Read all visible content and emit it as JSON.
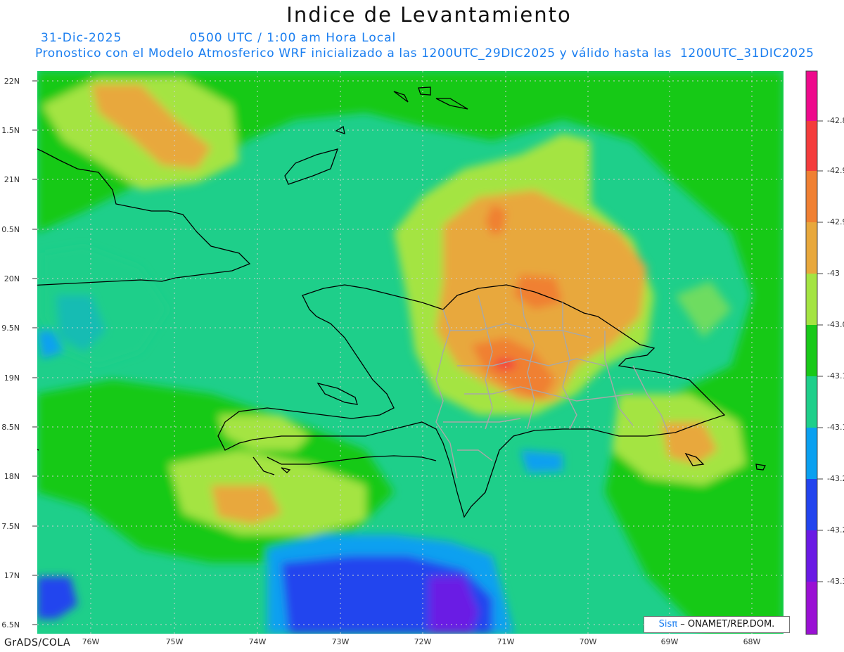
{
  "header": {
    "title": "Indice de Levantamiento",
    "date": "31-Dic-2025",
    "time": "0500 UTC / 1:00 am Hora Local",
    "subtitle": "Pronostico con el Modelo Atmosferico WRF inicializado a las 1200UTC_29DIC2025 y válido hasta las  1200UTC_31DIC2025"
  },
  "axes": {
    "lat_labels": [
      "22N",
      "1.5N",
      "21N",
      "0.5N",
      "20N",
      "9.5N",
      "19N",
      "8.5N",
      "18N",
      "7.5N",
      "17N",
      "6.5N"
    ],
    "lon_labels": [
      "76W",
      "75W",
      "74W",
      "73W",
      "72W",
      "71W",
      "70W",
      "69W",
      "68W"
    ]
  },
  "colorbar": {
    "labels": [
      "-42.8",
      "-42.9",
      "-42.9",
      "-43",
      "-43.0",
      "-43.1",
      "-43.1",
      "-43.2",
      "-43.2",
      "-43.3"
    ],
    "colors": [
      "#ee0a8c",
      "#f43c3c",
      "#f08032",
      "#e8a83c",
      "#a4e442",
      "#18c918",
      "#1ecf8a",
      "#0aa0f0",
      "#2244ee",
      "#6a1ae4",
      "#9a10d4"
    ]
  },
  "palette": {
    "land_border": "#000000",
    "province_border": "#a8a8a8",
    "grid": "#cfcfcf"
  },
  "footer": {
    "software": "GrADS/COLA",
    "credit_brand": "Sisπ",
    "credit_text": "– ONAMET/REP.DOM."
  }
}
